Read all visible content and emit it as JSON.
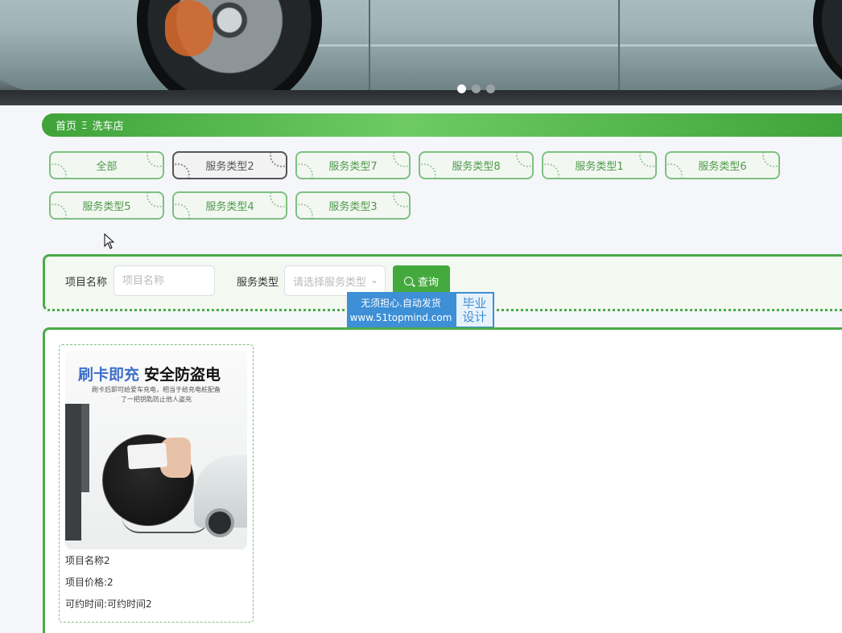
{
  "banner": {
    "slide_count": 3,
    "active_slide": 1
  },
  "breadcrumb": {
    "home": "首页",
    "separator": "Ξ",
    "current": "洗车店"
  },
  "categories": [
    {
      "label": "全部",
      "active": false
    },
    {
      "label": "服务类型2",
      "active": true
    },
    {
      "label": "服务类型7",
      "active": false
    },
    {
      "label": "服务类型8",
      "active": false
    },
    {
      "label": "服务类型1",
      "active": false
    },
    {
      "label": "服务类型6",
      "active": false
    },
    {
      "label": "服务类型5",
      "active": false
    },
    {
      "label": "服务类型4",
      "active": false
    },
    {
      "label": "服务类型3",
      "active": false
    }
  ],
  "search": {
    "name_label": "项目名称",
    "name_placeholder": "项目名称",
    "name_value": "",
    "type_label": "服务类型",
    "type_placeholder": "请选择服务类型",
    "query_label": "查询"
  },
  "watermark": {
    "line1": "无须担心.自动发货",
    "line2": "www.51topmind.com",
    "right1": "毕业",
    "right2": "设计"
  },
  "items": [
    {
      "image": {
        "title_blue": "刷卡即充",
        "title_black": "安全防盗电",
        "sub1": "刷卡后即可给爱车充电，相当于给充电桩配备",
        "sub2": "了一把钥匙防止他人盗充"
      },
      "name": "项目名称2",
      "price": "项目价格:2",
      "time": "可约时间:可约时间2"
    }
  ],
  "colors": {
    "primary_green": "#43a93d",
    "category_border": "#7ec081",
    "active_category_border": "#555555",
    "page_background": "#f5f6fa"
  }
}
